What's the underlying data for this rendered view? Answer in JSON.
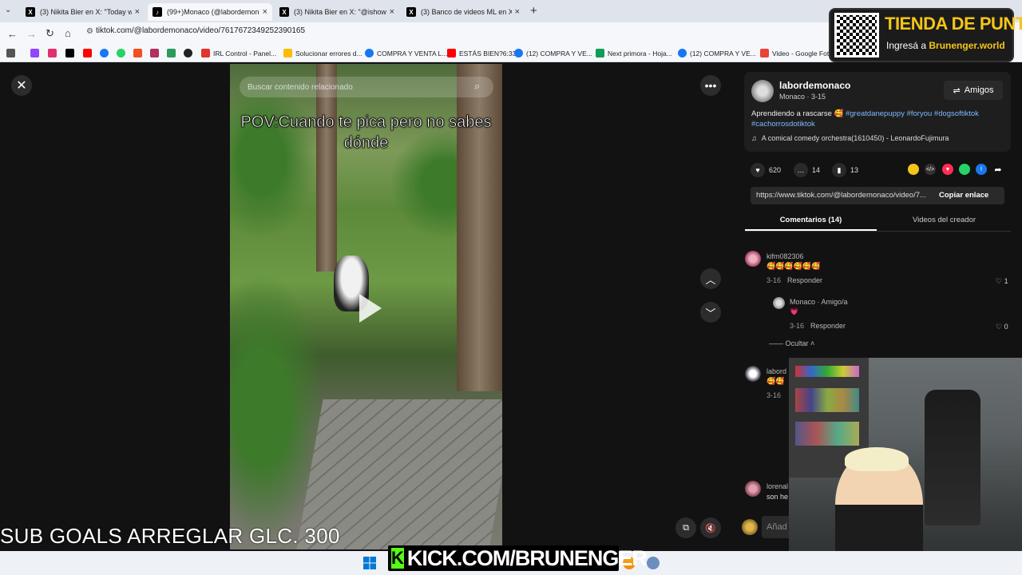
{
  "browser": {
    "tabs": [
      {
        "title": "(3) Nikita Bier en X: \"Today we",
        "icon": "x-icon",
        "active": false
      },
      {
        "title": "(99+)Monaco (@labordemonac",
        "icon": "tiktok-icon",
        "active": true
      },
      {
        "title": "(3) Nikita Bier en X: \"@ishowsp",
        "icon": "x-icon",
        "active": false
      },
      {
        "title": "(3) Banco de videos ML en X: \"",
        "icon": "x-icon",
        "active": false
      }
    ],
    "new_tab": "+",
    "url": "tiktok.com/@labordemonaco/video/7617672349252390165",
    "bookmarks": [
      {
        "label": "IRL Control - Panel...",
        "color": "#e0342c"
      },
      {
        "label": "Solucionar errores d...",
        "color": "#fbbc05"
      },
      {
        "label": "COMPRA Y VENTA L...",
        "color": "#1877f2"
      },
      {
        "label": "ESTÁS BIEN?6:33",
        "color": "#ff0000"
      },
      {
        "label": "(12) COMPRA Y VE...",
        "color": "#1877f2"
      },
      {
        "label": "Next primora - Hoja...",
        "color": "#0f9d58"
      },
      {
        "label": "(12) COMPRA Y VE...",
        "color": "#1877f2"
      },
      {
        "label": "Video - Google Foto...",
        "color": "#ea4335"
      }
    ]
  },
  "video": {
    "search_placeholder": "Buscar contenido relacionado",
    "caption": "POV:Cuando te pica pero no sabes dónde",
    "sub_goals": "SUB GOALS ARREGLAR GLC. 300"
  },
  "panel": {
    "username": "labordemonaco",
    "subline": "Monaco · 3-15",
    "friends_label": "Amigos",
    "description_text": "Aprendiendo a rascarse 🥰 ",
    "hashtags": [
      "#greatdanepuppy",
      "#foryou",
      "#dogsoftiktok",
      "#cachorrosdotiktok"
    ],
    "music": "A comical comedy orchestra(1610450) - LeonardoFujimura",
    "likes": "620",
    "comments": "14",
    "saves": "13",
    "link": "https://www.tiktok.com/@labordemonaco/video/7...",
    "copy_label": "Copiar enlace",
    "tab_comments": "Comentarios (14)",
    "tab_creator": "Videos del creador",
    "comment_list": [
      {
        "name": "kifm082306",
        "text": "🥰🥰🥰🥰🥰🥰",
        "date": "3-16",
        "reply": "Responder",
        "likes": "1"
      },
      {
        "name": "Monaco · Amigo/a",
        "text": "💗",
        "date": "3-16",
        "reply": "Responder",
        "likes": "0"
      },
      {
        "name": "labord",
        "text": "🥰🥰",
        "date": "3-16",
        "reply": "",
        "likes": ""
      },
      {
        "name": "lorenal",
        "text": "son he",
        "date": "",
        "reply": "",
        "likes": ""
      }
    ],
    "hide_label": "Ocultar",
    "add_comment": "Añad"
  },
  "overlay": {
    "tienda_title": "TIENDA DE PUNTOS",
    "tienda_sub_prefix": "Ingresá a ",
    "tienda_sub_link": "Brunenger.world",
    "kick_text": "KICK.COM/BRUNENGER",
    "kick_logo": "K"
  }
}
